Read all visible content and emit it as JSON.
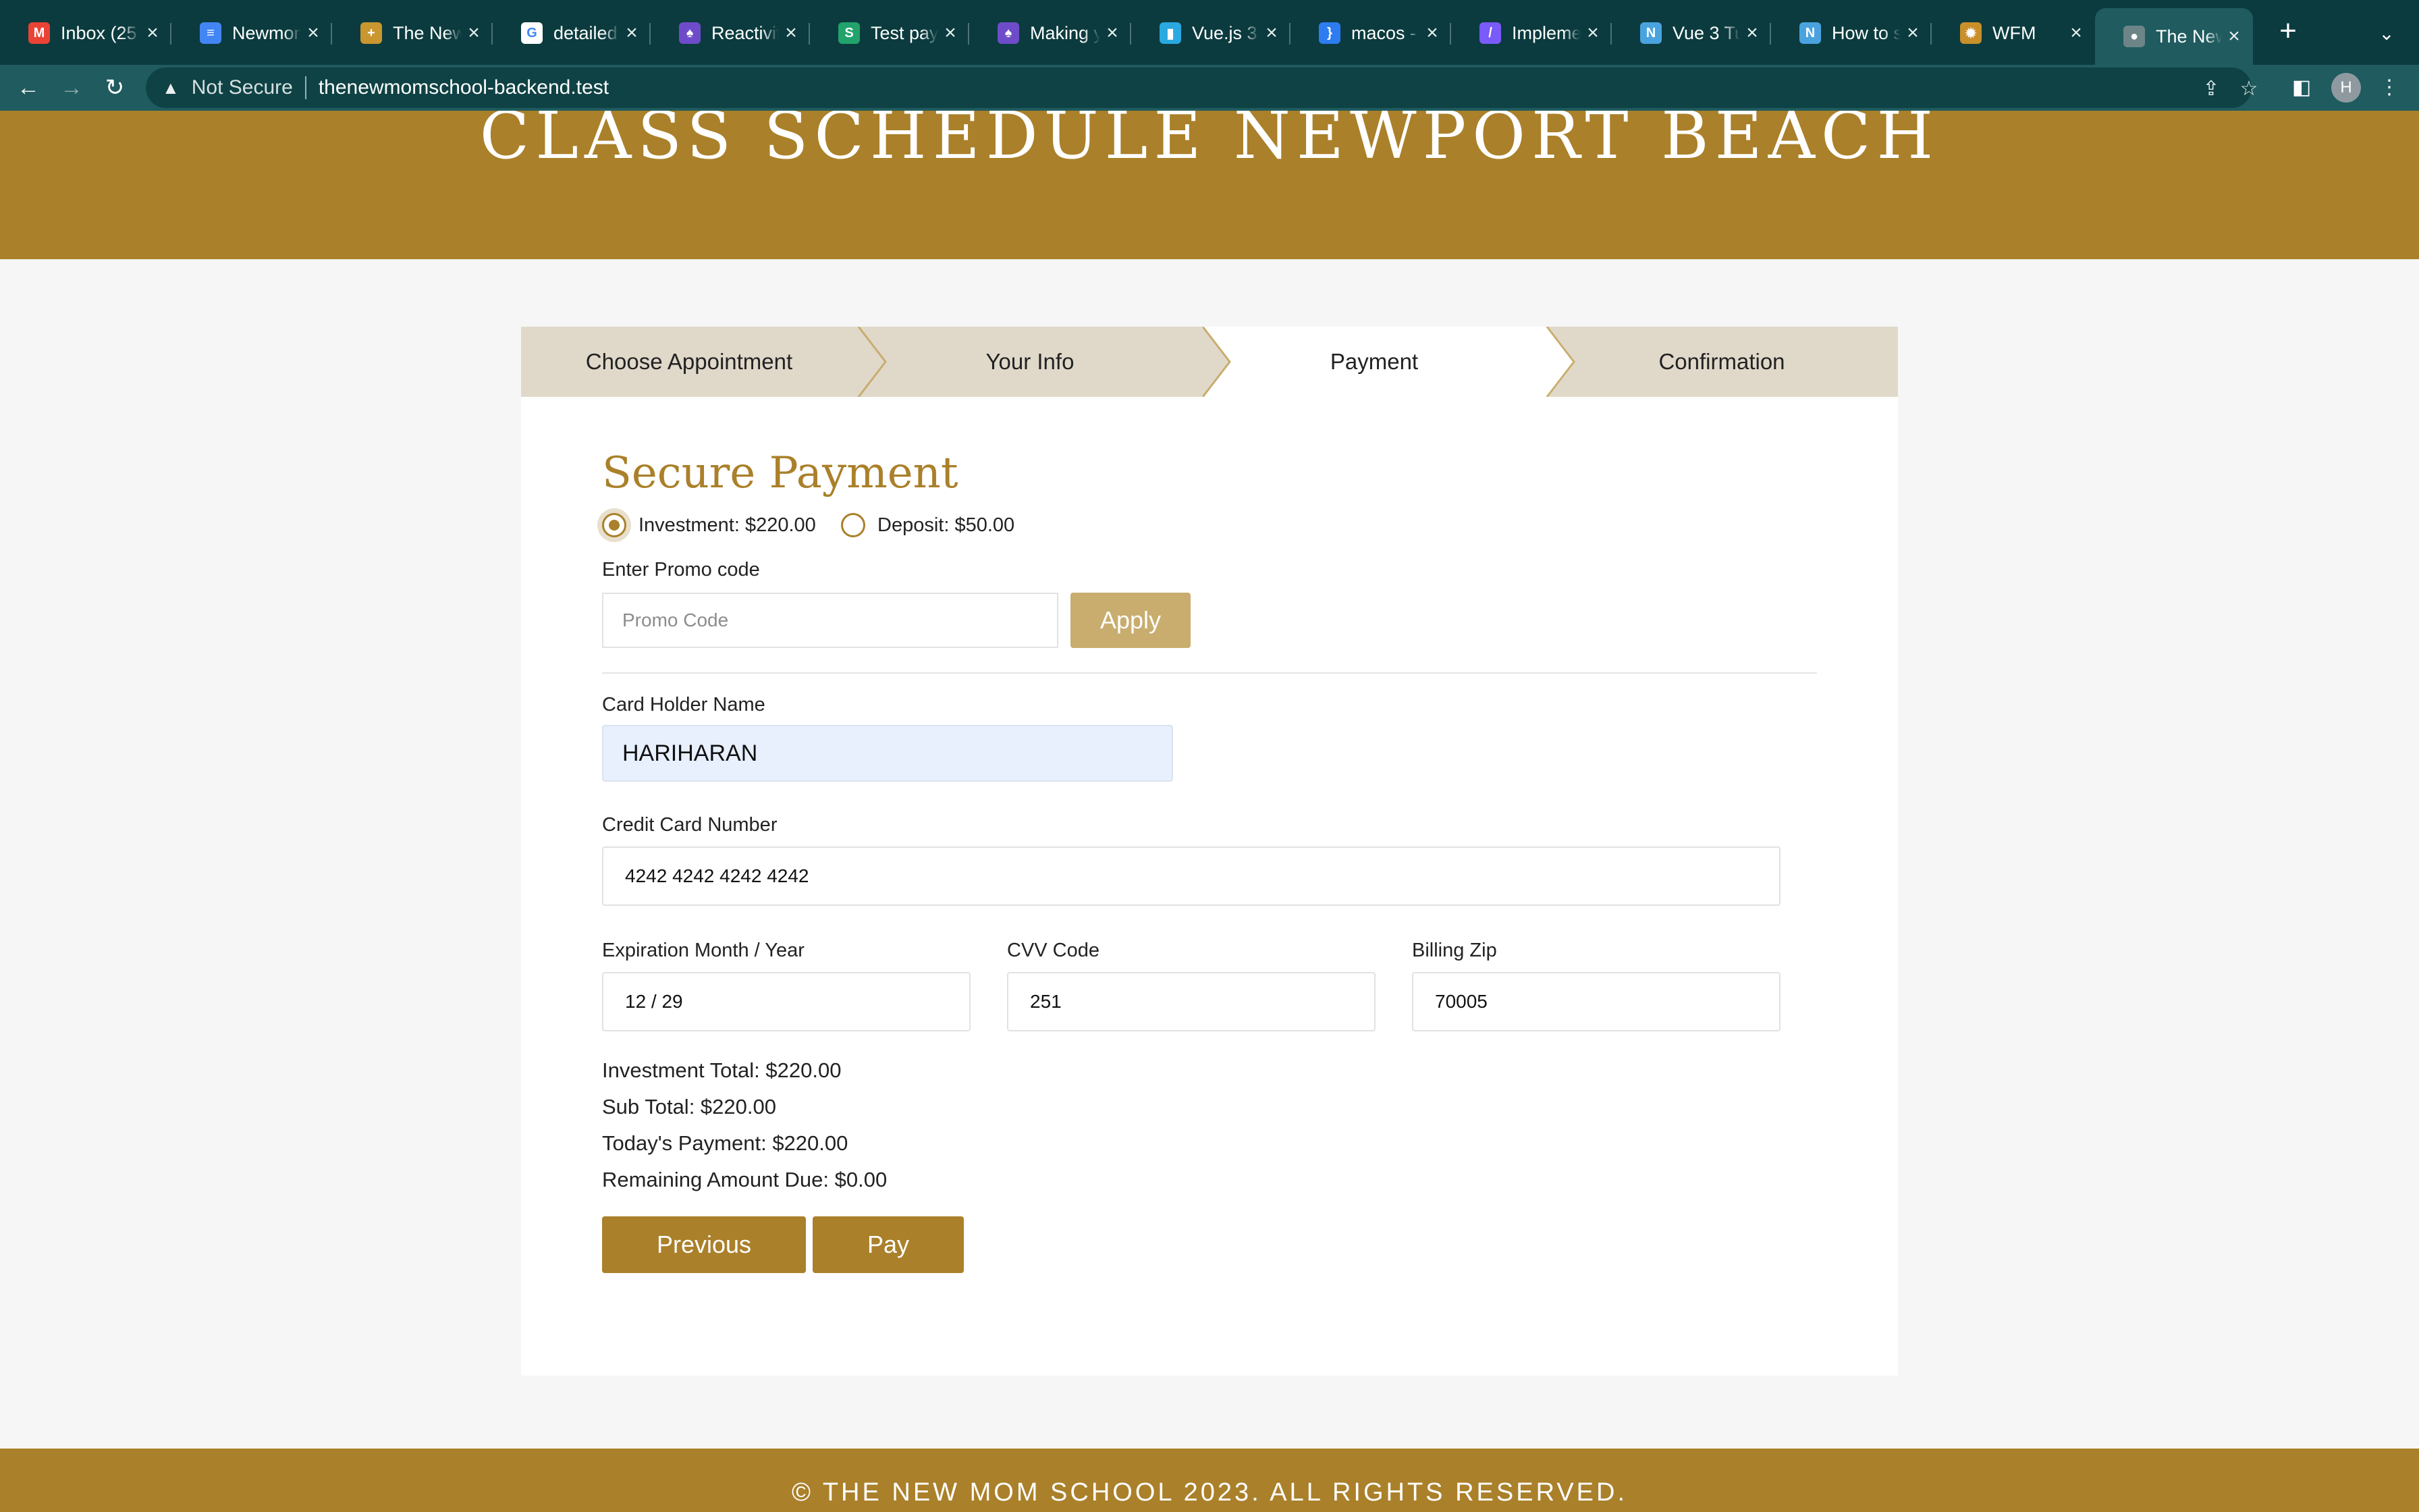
{
  "browser": {
    "tabs": [
      {
        "title": "Inbox (25",
        "icon": "gmail-icon",
        "color": "#ea4335",
        "glyph": "M"
      },
      {
        "title": "Newmom",
        "icon": "docs-icon",
        "color": "#4285f4",
        "glyph": "≡"
      },
      {
        "title": "The New",
        "icon": "site-icon",
        "color": "#c9962f",
        "glyph": "+"
      },
      {
        "title": "detailed",
        "icon": "google-icon",
        "color": "#ffffff",
        "glyph": "G"
      },
      {
        "title": "Reactivit",
        "icon": "rocket-icon",
        "color": "#6e4cc9",
        "glyph": "♠"
      },
      {
        "title": "Test pay",
        "icon": "stripe-icon",
        "color": "#21a36b",
        "glyph": "S"
      },
      {
        "title": "Making y",
        "icon": "rocket-icon",
        "color": "#6e4cc9",
        "glyph": "♠"
      },
      {
        "title": "Vue.js 3",
        "icon": "chart-icon",
        "color": "#29a9e0",
        "glyph": "▮"
      },
      {
        "title": "macos -",
        "icon": "bracket-icon",
        "color": "#2d7cf0",
        "glyph": "}"
      },
      {
        "title": "Impleme",
        "icon": "stripe-icon",
        "color": "#7a5af8",
        "glyph": "/"
      },
      {
        "title": "Vue 3 Tu",
        "icon": "vue-icon",
        "color": "#4aa3df",
        "glyph": "N"
      },
      {
        "title": "How to s",
        "icon": "vue-icon",
        "color": "#4aa3df",
        "glyph": "N"
      },
      {
        "title": "WFM",
        "icon": "wfm-icon",
        "color": "#c98f2a",
        "glyph": "✹"
      },
      {
        "title": "The New",
        "icon": "globe-icon",
        "color": "#6d8587",
        "glyph": "●",
        "active": true
      }
    ],
    "security_label": "Not Secure",
    "url": "thenewmomschool-backend.test",
    "avatar_initial": "H"
  },
  "hero": {
    "title": "CLASS SCHEDULE NEWPORT BEACH"
  },
  "steps": [
    {
      "label": "Choose Appointment",
      "active": false
    },
    {
      "label": "Your Info",
      "active": false
    },
    {
      "label": "Payment",
      "active": true
    },
    {
      "label": "Confirmation",
      "active": false
    }
  ],
  "payment": {
    "heading": "Secure Payment",
    "options": [
      {
        "label": "Investment: $220.00",
        "selected": true
      },
      {
        "label": "Deposit: $50.00",
        "selected": false
      }
    ],
    "promo_label": "Enter Promo code",
    "promo_placeholder": "Promo Code",
    "apply_label": "Apply",
    "card_holder_label": "Card Holder Name",
    "card_holder_value": "HARIHARAN",
    "card_number_label": "Credit Card Number",
    "card_number_value": "4242 4242 4242 4242",
    "expiry_label": "Expiration Month / Year",
    "expiry_value": "12 / 29",
    "cvv_label": "CVV Code",
    "cvv_value": "251",
    "zip_label": "Billing Zip",
    "zip_value": "70005",
    "summary": {
      "investment_total": "Investment Total: $220.00",
      "sub_total": "Sub Total: $220.00",
      "todays_payment": "Today's Payment: $220.00",
      "remaining_due": "Remaining Amount Due: $0.00"
    },
    "previous_label": "Previous",
    "pay_label": "Pay"
  },
  "footer": {
    "text": "© THE NEW MOM SCHOOL 2023. ALL RIGHTS RESERVED."
  },
  "colors": {
    "brand_gold": "#aa802a",
    "apply_gold": "#c8ad6e",
    "steps_bg": "#e0d9ca",
    "chrome_dark": "#0b3b3e",
    "chrome_toolbar": "#1f5b5f"
  }
}
